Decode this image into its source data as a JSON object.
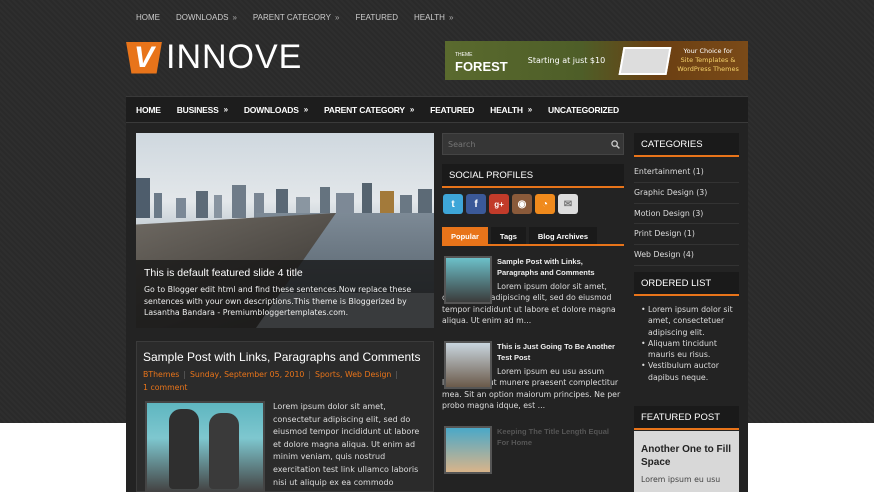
{
  "top_nav": [
    {
      "label": "HOME",
      "arrow": ""
    },
    {
      "label": "DOWNLOADS",
      "arrow": "»"
    },
    {
      "label": "PARENT CATEGORY",
      "arrow": "»"
    },
    {
      "label": "FEATURED",
      "arrow": ""
    },
    {
      "label": "HEALTH",
      "arrow": "»"
    }
  ],
  "logo": {
    "mark": "V",
    "text": "INNOVE"
  },
  "banner": {
    "brand": "FOREST",
    "brand_small": "THEME",
    "offer": "Starting at just $10",
    "choice_line1": "Your Choice for",
    "choice_line2": "Site Templates &",
    "choice_line3": "WordPress Themes"
  },
  "main_nav": [
    {
      "label": "HOME",
      "arrow": ""
    },
    {
      "label": "BUSINESS",
      "arrow": "»"
    },
    {
      "label": "DOWNLOADS",
      "arrow": "»"
    },
    {
      "label": "PARENT CATEGORY",
      "arrow": "»"
    },
    {
      "label": "FEATURED",
      "arrow": ""
    },
    {
      "label": "HEALTH",
      "arrow": "»"
    },
    {
      "label": "UNCATEGORIZED",
      "arrow": ""
    }
  ],
  "slider": {
    "title": "This is default featured slide 4 title",
    "text": "Go to Blogger edit html and find these sentences.Now replace these sentences with your own descriptions.This theme is Bloggerized by Lasantha Bandara - Premiumbloggertemplates.com."
  },
  "post": {
    "title": "Sample Post with Links, Paragraphs and Comments",
    "author": "BThemes",
    "date": "Sunday, September 05, 2010",
    "labels": "Sports, Web Design",
    "comments": "1 comment",
    "excerpt": "Lorem ipsum dolor sit amet, consectetur adipiscing elit, sed do eiusmod tempor incididunt ut labore et dolore magna aliqua. Ut enim ad minim veniam, quis nostrud exercitation test link ullamco laboris nisi ut aliquip ex ea commodo"
  },
  "search": {
    "placeholder": "Search"
  },
  "social": {
    "title": "SOCIAL PROFILES",
    "icons": [
      {
        "name": "twitter-icon",
        "glyph": "t",
        "color": "#3ea6d8"
      },
      {
        "name": "facebook-icon",
        "glyph": "f",
        "color": "#3b5998"
      },
      {
        "name": "google-plus-icon",
        "glyph": "g+",
        "color": "#c23b2a"
      },
      {
        "name": "instagram-icon",
        "glyph": "◉",
        "color": "#8a5a3a"
      },
      {
        "name": "rss-icon",
        "glyph": "◔",
        "color": "#f08a1c"
      },
      {
        "name": "email-icon",
        "glyph": "✉",
        "color": "#dddddd"
      }
    ]
  },
  "tabs": [
    {
      "label": "Popular",
      "active": true
    },
    {
      "label": "Tags",
      "active": false
    },
    {
      "label": "Blog Archives",
      "active": false
    }
  ],
  "popular": [
    {
      "title": "Sample Post with Links, Paragraphs and Comments",
      "text": "Lorem ipsum dolor sit amet, consectetur adipiscing elit, sed do eiusmod tempor incididunt ut labore et dolore magna aliqua. Ut enim ad m..."
    },
    {
      "title": "This is Just Going To Be Another Test Post",
      "text": "Lorem ipsum eu usu assum liberavisse, ut munere praesent complectitur mea. Sit an option maiorum principes. Ne per probo magna idque, est ..."
    },
    {
      "title": "Keeping The Title Length Equal For Home",
      "text": ""
    }
  ],
  "categories": {
    "title": "CATEGORIES",
    "items": [
      "Entertainment (1)",
      "Graphic Design (3)",
      "Motion Design (3)",
      "Print Design (1)",
      "Web Design (4)"
    ]
  },
  "ordered_list": {
    "title": "ORDERED LIST",
    "items": [
      "Lorem ipsum dolor sit amet, consectetuer adipiscing elit.",
      "Aliquam tincidunt mauris eu risus.",
      "Vestibulum auctor dapibus neque."
    ]
  },
  "featured_post": {
    "title": "FEATURED POST",
    "heading": "Another One to Fill Space",
    "text": "Lorem ipsum eu usu"
  }
}
